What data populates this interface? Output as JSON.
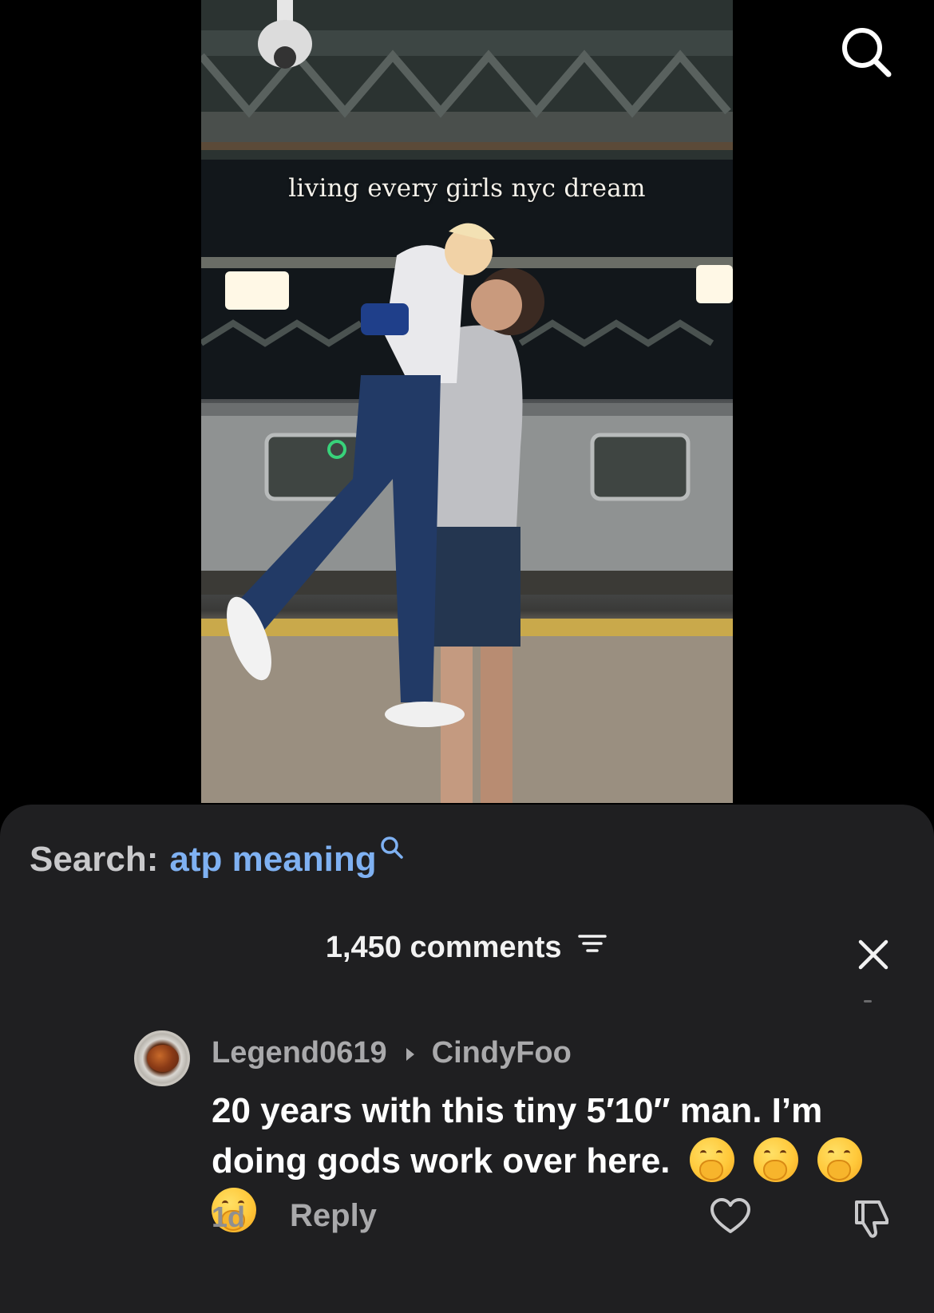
{
  "video": {
    "caption": "living every girls nyc dream",
    "search_icon": "search-icon"
  },
  "comments_sheet": {
    "search_label": "Search:",
    "search_query": "atp meaning",
    "comments_count": "1,450 comments",
    "filter_icon": "filter-icon",
    "close_icon": "close-icon",
    "comment": {
      "username": "Legend0619",
      "reply_to": "CindyFoo",
      "text": "20 years with this tiny 5′10″ man. I’m doing gods work over here.",
      "emoji": "🤭",
      "emoji_count": 4,
      "time": "1d",
      "reply_label": "Reply",
      "like_icon": "heart-icon",
      "dislike_icon": "thumbs-down-icon"
    }
  },
  "colors": {
    "sheet_background": "#1f1f21",
    "search_query": "#7fb1f2",
    "secondary_text": "#a9a9ab"
  }
}
